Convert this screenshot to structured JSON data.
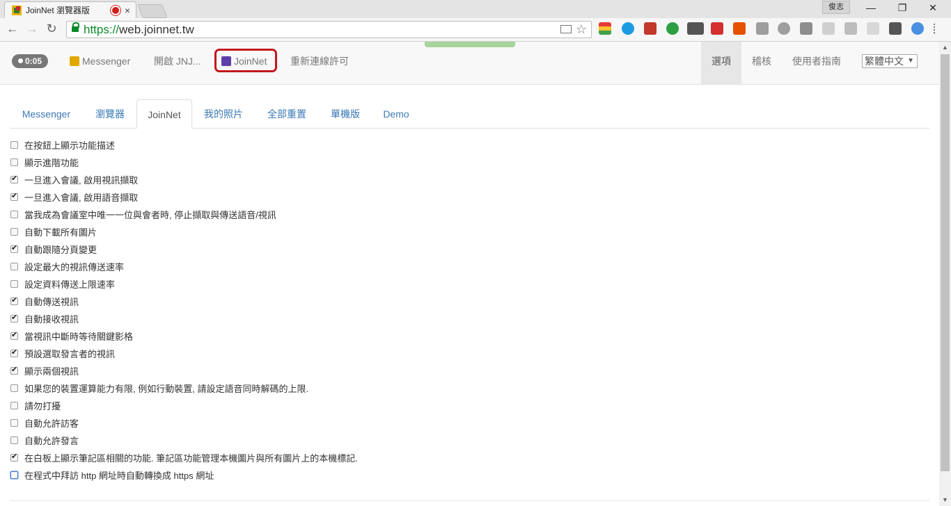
{
  "browser": {
    "tab_title": "JoinNet 瀏覽器版",
    "tab_close": "×",
    "user_chip": "俊志",
    "win_minimize": "—",
    "win_restore": "❐",
    "win_close": "✕",
    "back": "←",
    "forward": "→",
    "reload": "↻",
    "url_scheme": "https://",
    "url_host": "web.joinnet.tw",
    "star": "☆"
  },
  "navbar": {
    "timer": "0:05",
    "links": [
      "Messenger",
      "開啟 JNJ...",
      "JoinNet",
      "重新連線許可"
    ],
    "right_links": [
      "選項",
      "稽核",
      "使用者指南"
    ],
    "language": "繁體中文",
    "language_arrow": "▼"
  },
  "tabs": [
    "Messenger",
    "瀏覽器",
    "JoinNet",
    "我的照片",
    "全部重置",
    "單機版",
    "Demo"
  ],
  "active_tab": "JoinNet",
  "options": [
    {
      "label": "在按鈕上顯示功能描述",
      "checked": false
    },
    {
      "label": "顯示進階功能",
      "checked": false
    },
    {
      "label": "一旦進入會議, 啟用視訊擷取",
      "checked": true
    },
    {
      "label": "一旦進入會議, 啟用語音擷取",
      "checked": true
    },
    {
      "label": "當我成為會議室中唯一一位與會者時, 停止擷取與傳送語音/視訊",
      "checked": false
    },
    {
      "label": "自動下載所有圖片",
      "checked": false
    },
    {
      "label": "自動跟隨分頁變更",
      "checked": true
    },
    {
      "label": "設定最大的視訊傳送速率",
      "checked": false
    },
    {
      "label": "設定資料傳送上限速率",
      "checked": false
    },
    {
      "label": "自動傳送視訊",
      "checked": true
    },
    {
      "label": "自動接收視訊",
      "checked": true
    },
    {
      "label": "當視訊中斷時等待關鍵影格",
      "checked": true
    },
    {
      "label": "預設選取發言者的視訊",
      "checked": true
    },
    {
      "label": "顯示兩個視訊",
      "checked": true
    },
    {
      "label": "如果您的裝置運算能力有限, 例如行動裝置, 請設定語音同時解碼的上限.",
      "checked": false
    },
    {
      "label": "請勿打擾",
      "checked": false
    },
    {
      "label": "自動允許訪客",
      "checked": false
    },
    {
      "label": "自動允許發言",
      "checked": false
    },
    {
      "label": "在白板上顯示筆記區相關的功能. 筆記區功能管理本機圖片與所有圖片上的本機標記.",
      "checked": true
    },
    {
      "label": "在程式中拜訪 http 網址時自動轉換成 https 網址",
      "checked": false,
      "focused": true
    }
  ],
  "scroll": {
    "up": "▲",
    "down": "▼"
  },
  "colors": {
    "accent_link": "#3a78b5",
    "highlight": "#c2181e",
    "https_green": "#0a8a2a"
  }
}
